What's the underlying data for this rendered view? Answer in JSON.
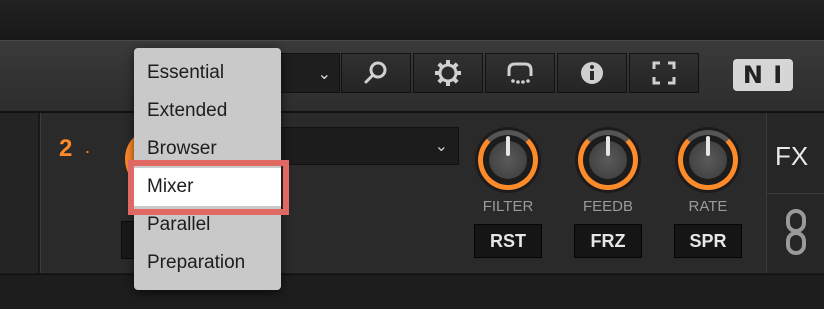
{
  "deck": {
    "number": "2",
    "dot": "."
  },
  "knobs": [
    {
      "label": "FILTER",
      "button": "RST"
    },
    {
      "label": "FEEDB",
      "button": "FRZ"
    },
    {
      "label": "RATE",
      "button": "SPR"
    }
  ],
  "fx_panel": {
    "label": "FX"
  },
  "logo": {
    "text": "N I"
  },
  "layout_menu": {
    "items": [
      {
        "label": "Essential"
      },
      {
        "label": "Extended"
      },
      {
        "label": "Browser"
      },
      {
        "label": "Mixer",
        "selected": true
      },
      {
        "label": "Parallel"
      },
      {
        "label": "Preparation"
      }
    ]
  },
  "icons": {
    "dropdown": "chevron-down-icon",
    "search": "search-icon",
    "settings": "gear-icon",
    "loop": "loop-icon",
    "info": "info-icon",
    "fullscreen": "fullscreen-icon",
    "link": "chain-icon"
  },
  "colors": {
    "accent": "#ff8a2a",
    "highlight": "#e06a63",
    "menu_bg": "#c9c9c9"
  }
}
